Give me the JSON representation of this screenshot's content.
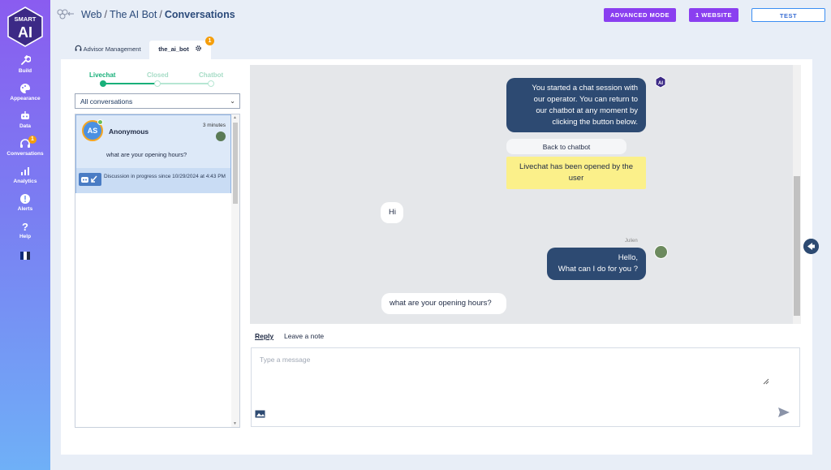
{
  "sidebar": {
    "logo_top": "SMART",
    "logo_main": "AI",
    "items": [
      {
        "label": "Build",
        "icon": "wrench-icon"
      },
      {
        "label": "Appearance",
        "icon": "palette-icon"
      },
      {
        "label": "Data",
        "icon": "robot-icon"
      },
      {
        "label": "Conversations",
        "icon": "headset-icon",
        "badge": "1"
      },
      {
        "label": "Analytics",
        "icon": "bar-chart-icon"
      },
      {
        "label": "Alerts",
        "icon": "alert-icon"
      },
      {
        "label": "Help",
        "icon": "help-icon"
      }
    ],
    "flag_colors": [
      "#0d2a7a",
      "#ffffff",
      "#1f2a44"
    ]
  },
  "header": {
    "crumb_1": "Web",
    "crumb_2": "The AI Bot",
    "crumb_3": "Conversations",
    "separator": "/",
    "advanced_mode": "ADVANCED MODE",
    "website": "1 WEBSITE",
    "test": "TEST"
  },
  "tabs": {
    "advisor": "Advisor Management",
    "bot": "the_ai_bot",
    "bot_badge": "1"
  },
  "stepper": {
    "livechat": "Livechat",
    "closed": "Closed",
    "chatbot": "Chatbot"
  },
  "filter": {
    "selected": "All conversations"
  },
  "conversation": {
    "initials": "AS",
    "name": "Anonymous",
    "time": "3 minutes",
    "last_message": "what are your opening hours?",
    "status": "Discussion in progress since 10/29/2024 at 4:43 PM"
  },
  "chat": {
    "bot_message": [
      "You started a chat session with",
      "our operator. You can return to",
      "our chatbot at any moment by",
      "clicking the button below."
    ],
    "back_button": "Back to chatbot",
    "livechat_notice": [
      "Livechat has been opened by the",
      "user"
    ],
    "user_hi": "Hi",
    "agent_name": "Julien",
    "agent_message": [
      "Hello,",
      "What can I do for you ?"
    ],
    "user_question": "what are your opening hours?"
  },
  "reply": {
    "tab_reply": "Reply",
    "tab_note": "Leave a note",
    "placeholder": "Type a message"
  },
  "colors": {
    "accent_purple": "#8a3ff0",
    "bot_bubble": "#2d4a72",
    "notice_yellow": "#fbf08a",
    "active_green": "#19b07a"
  }
}
